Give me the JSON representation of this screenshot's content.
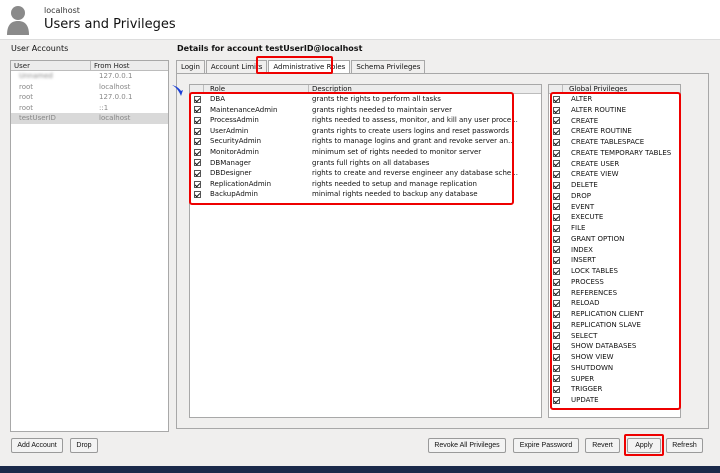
{
  "header": {
    "host": "localhost",
    "title": "Users and Privileges"
  },
  "accounts": {
    "title": "User Accounts",
    "columns": [
      "User",
      "From Host"
    ],
    "rows": [
      {
        "user": "Unnamed",
        "host": "127.0.0.1",
        "blurred": true
      },
      {
        "user": "root",
        "host": "localhost"
      },
      {
        "user": "root",
        "host": "127.0.0.1"
      },
      {
        "user": "root",
        "host": "::1"
      },
      {
        "user": "testUserID",
        "host": "localhost",
        "selected": true
      }
    ]
  },
  "details": {
    "title": "Details for account testUserID@localhost",
    "tabs": [
      "Login",
      "Account Limits",
      "Administrative Roles",
      "Schema Privileges"
    ],
    "active_tab": "Administrative Roles"
  },
  "roles": {
    "columns": [
      "Role",
      "Description"
    ],
    "rows": [
      {
        "name": "DBA",
        "desc": "grants the rights to perform all tasks",
        "checked": true
      },
      {
        "name": "MaintenanceAdmin",
        "desc": "grants rights needed to maintain server",
        "checked": true
      },
      {
        "name": "ProcessAdmin",
        "desc": "rights needed to assess, monitor, and kill any user proce...",
        "checked": true
      },
      {
        "name": "UserAdmin",
        "desc": "grants rights to create users logins and reset passwords",
        "checked": true
      },
      {
        "name": "SecurityAdmin",
        "desc": "rights to manage logins and grant and revoke server an...",
        "checked": true
      },
      {
        "name": "MonitorAdmin",
        "desc": "minimum set of rights needed to monitor server",
        "checked": true
      },
      {
        "name": "DBManager",
        "desc": "grants full rights on all databases",
        "checked": true
      },
      {
        "name": "DBDesigner",
        "desc": "rights to create and reverse engineer any database sche...",
        "checked": true
      },
      {
        "name": "ReplicationAdmin",
        "desc": "rights needed to setup and manage replication",
        "checked": true
      },
      {
        "name": "BackupAdmin",
        "desc": "minimal rights needed to backup any database",
        "checked": true
      }
    ]
  },
  "privileges": {
    "column": "Global Privileges",
    "items": [
      "ALTER",
      "ALTER ROUTINE",
      "CREATE",
      "CREATE ROUTINE",
      "CREATE TABLESPACE",
      "CREATE TEMPORARY TABLES",
      "CREATE USER",
      "CREATE VIEW",
      "DELETE",
      "DROP",
      "EVENT",
      "EXECUTE",
      "FILE",
      "GRANT OPTION",
      "INDEX",
      "INSERT",
      "LOCK TABLES",
      "PROCESS",
      "REFERENCES",
      "RELOAD",
      "REPLICATION CLIENT",
      "REPLICATION SLAVE",
      "SELECT",
      "SHOW DATABASES",
      "SHOW VIEW",
      "SHUTDOWN",
      "SUPER",
      "TRIGGER",
      "UPDATE"
    ]
  },
  "buttons": {
    "add_account": "Add Account",
    "drop": "Drop",
    "revoke_all": "Revoke All Privileges",
    "expire_password": "Expire Password",
    "revert": "Revert",
    "apply": "Apply",
    "refresh": "Refresh"
  },
  "colors": {
    "highlight": "#e00000",
    "arrow": "#1a3fd6",
    "footer": "#1b2a4a"
  },
  "icons": {
    "avatar": "user-silhouette-icon",
    "arrow": "pointer-arrow-icon",
    "checkbox": "checkbox-checked-icon"
  }
}
